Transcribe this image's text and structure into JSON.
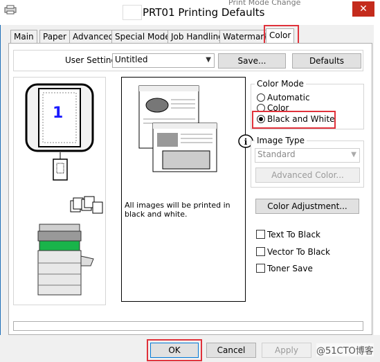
{
  "window": {
    "title": "PRT01 Printing Defaults",
    "close_symbol": "✕",
    "background_text": "Print Mode Change"
  },
  "tabs": [
    {
      "label": "Main"
    },
    {
      "label": "Paper"
    },
    {
      "label": "Advanced"
    },
    {
      "label": "Special Modes"
    },
    {
      "label": "Job Handling"
    },
    {
      "label": "Watermarks"
    },
    {
      "label": "Color",
      "selected": true
    }
  ],
  "user_settings": {
    "label": "User Settings:",
    "value": "Untitled",
    "save_label": "Save...",
    "defaults_label": "Defaults"
  },
  "preview": {
    "page_number": "1",
    "description": "All images will be printed in black and white."
  },
  "color_mode": {
    "legend": "Color Mode",
    "options": [
      "Automatic",
      "Color",
      "Black and White"
    ],
    "selected": "Black and White"
  },
  "image_type": {
    "legend": "Image Type",
    "value": "Standard",
    "advanced_label": "Advanced Color...",
    "enabled": false
  },
  "color_adjustment_label": "Color Adjustment...",
  "checkboxes": [
    {
      "label": "Text To Black",
      "checked": false
    },
    {
      "label": "Vector To Black",
      "checked": false
    },
    {
      "label": "Toner Save",
      "checked": false
    }
  ],
  "footer": {
    "ok_label": "OK",
    "cancel_label": "Cancel",
    "apply_label": "Apply",
    "watermark": "@51CTO博客"
  },
  "colors": {
    "accent_red": "#e0313a",
    "tray_green": "#19b44a",
    "close_red": "#c42b1c"
  }
}
